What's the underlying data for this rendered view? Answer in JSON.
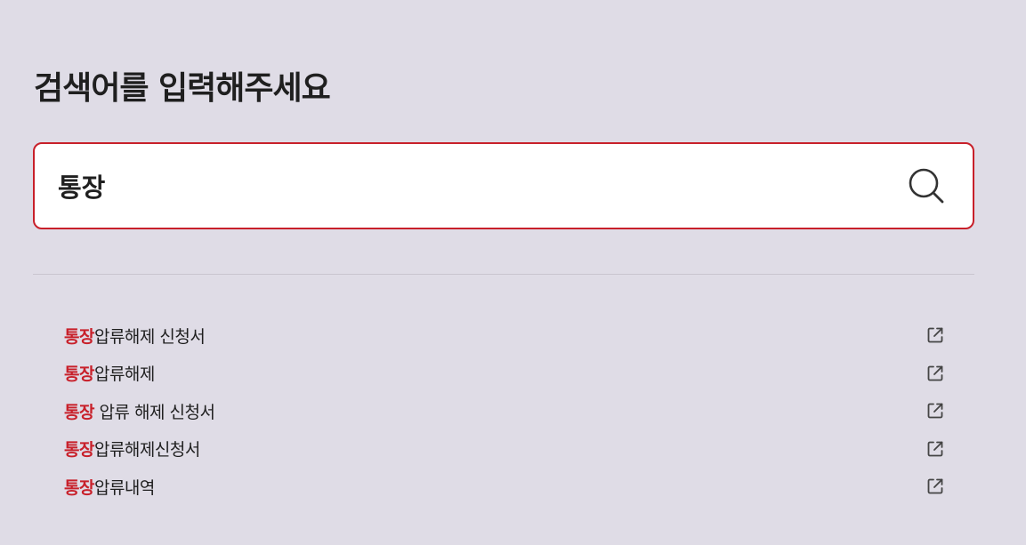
{
  "heading": "검색어를 입력해주세요",
  "search": {
    "value": "통장",
    "placeholder": "",
    "button_icon": "search-icon"
  },
  "colors": {
    "background": "#dfdce6",
    "accent": "#c8202a",
    "text": "#1f1f1f"
  },
  "suggestions": [
    {
      "highlight": "통장",
      "rest": "압류해제 신청서",
      "icon": "external-link-icon"
    },
    {
      "highlight": "통장",
      "rest": "압류해제",
      "icon": "external-link-icon"
    },
    {
      "highlight": "통장",
      "rest": " 압류 해제 신청서",
      "icon": "external-link-icon"
    },
    {
      "highlight": "통장",
      "rest": "압류해제신청서",
      "icon": "external-link-icon"
    },
    {
      "highlight": "통장",
      "rest": "압류내역",
      "icon": "external-link-icon"
    }
  ]
}
